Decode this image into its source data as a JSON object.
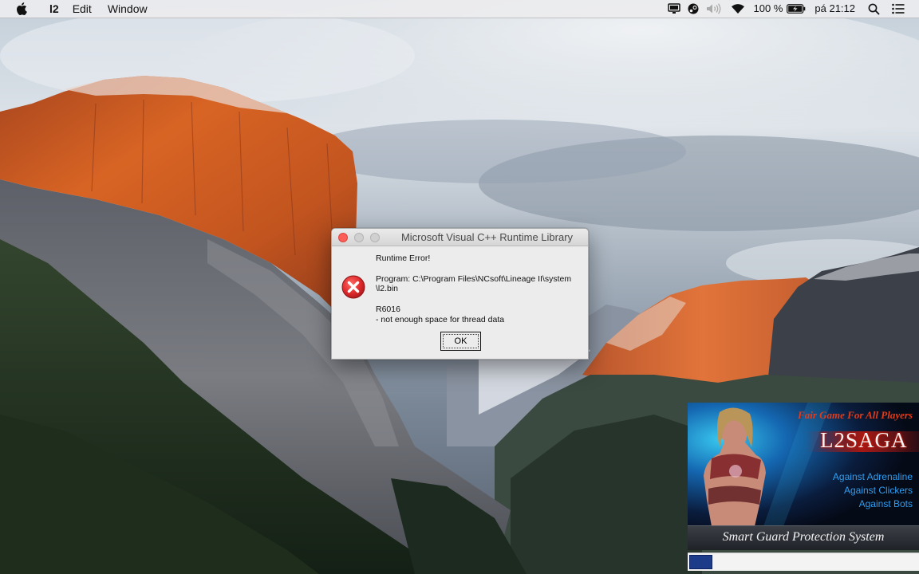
{
  "menubar": {
    "app_name": "l2",
    "menus": [
      "Edit",
      "Window"
    ],
    "battery_percent": "100 %",
    "clock": "pá 21:12"
  },
  "dialog": {
    "title": "Microsoft Visual C++ Runtime Library",
    "heading": "Runtime Error!",
    "program_line1": "Program: C:\\Program Files\\NCsoft\\Lineage II\\system",
    "program_line2": "\\l2.bin",
    "error_code": "R6016",
    "error_desc": "- not enough space for thread data",
    "ok_label": "OK"
  },
  "splash": {
    "tagline": "Fair Game For All Players",
    "logo": "L2SAGA",
    "features": [
      "Against Adrenaline",
      "Against Clickers",
      "Against Bots"
    ],
    "bottom_text": "Smart Guard Protection System",
    "progress": 0.1
  },
  "colors": {
    "error_red": "#d8262b",
    "splash_tagline": "#e33b18",
    "splash_feature": "#2e9ef0",
    "progress_fill": "#1c3c8a"
  }
}
